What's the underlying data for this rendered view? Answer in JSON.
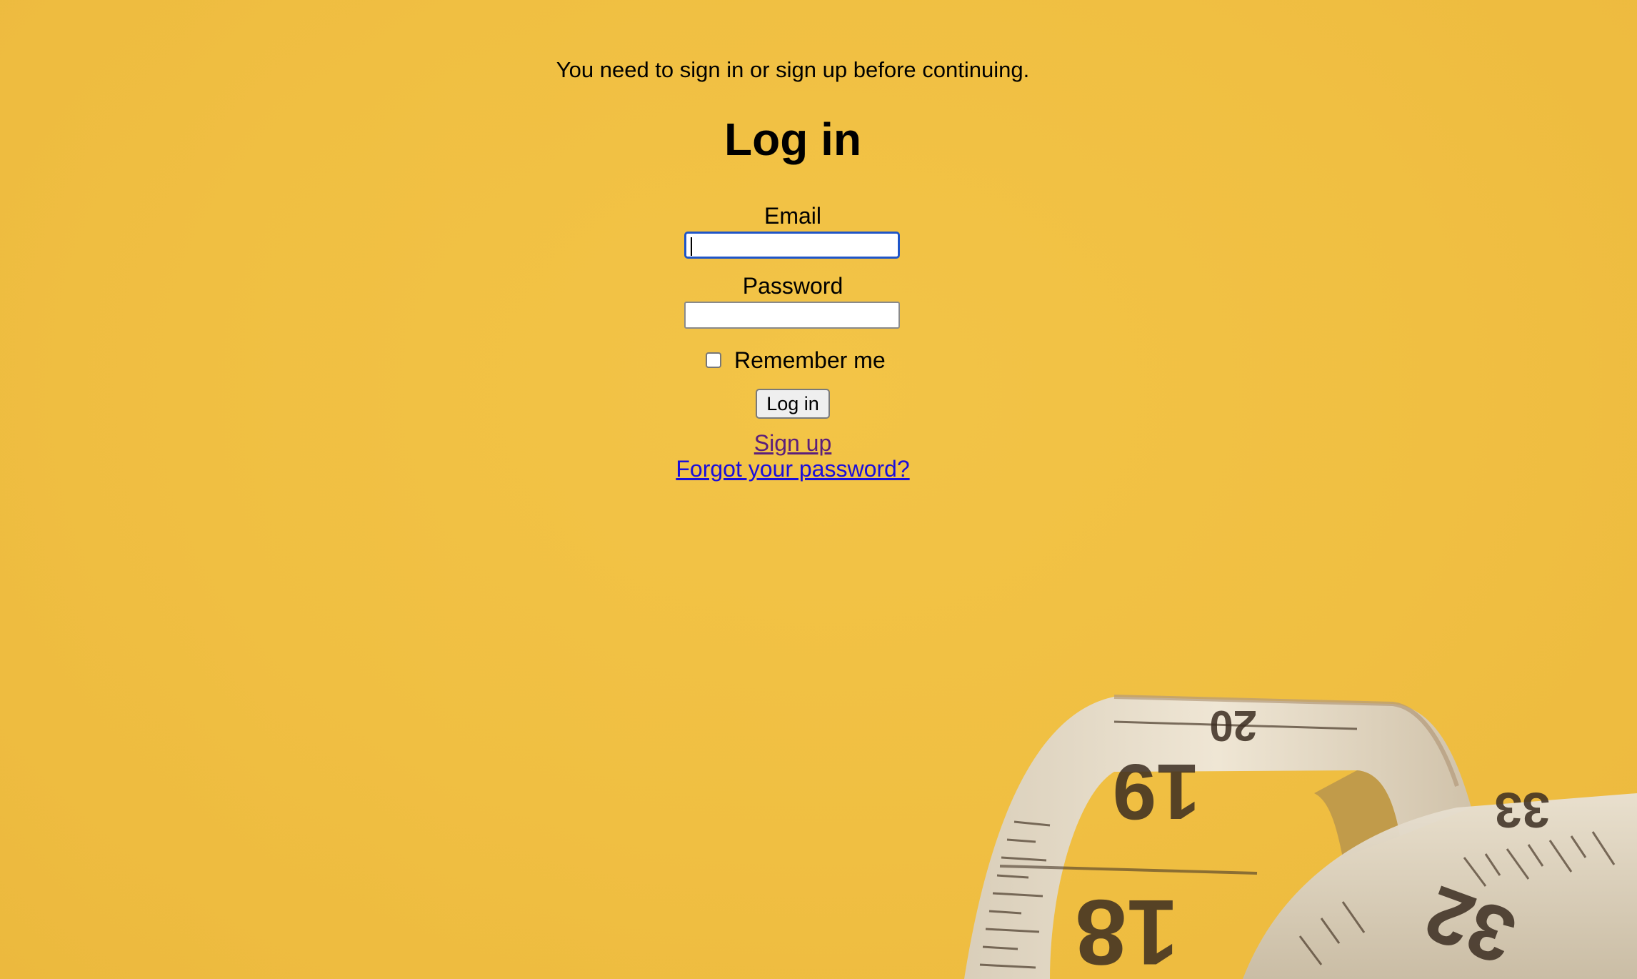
{
  "notice": "You need to sign in or sign up before continuing.",
  "title": "Log in",
  "form": {
    "email_label": "Email",
    "email_value": "",
    "password_label": "Password",
    "password_value": "",
    "remember_label": "Remember me",
    "remember_checked": false,
    "submit_label": "Log in"
  },
  "links": {
    "sign_up": "Sign up",
    "forgot_password": "Forgot your password?"
  },
  "background": {
    "color": "#f0c044",
    "image": "tape-measure",
    "tape_numbers": [
      "20",
      "19",
      "18",
      "32",
      "33"
    ]
  }
}
